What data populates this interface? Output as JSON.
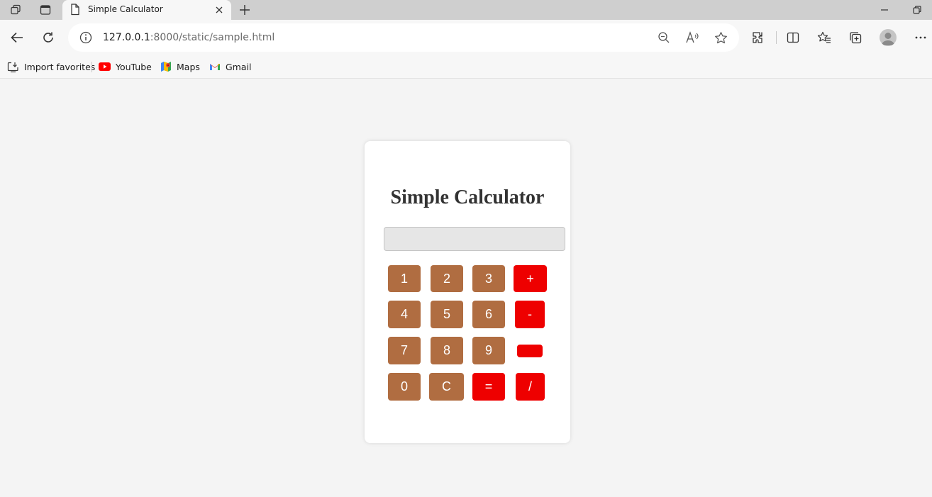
{
  "browser": {
    "tab_title": "Simple Calculator",
    "url_host": "127.0.0.1",
    "url_path": ":8000/static/sample.html",
    "bookmarks": [
      {
        "label": "Import favorites",
        "icon": "import-icon"
      },
      {
        "label": "YouTube",
        "icon": "youtube-icon"
      },
      {
        "label": "Maps",
        "icon": "maps-icon"
      },
      {
        "label": "Gmail",
        "icon": "gmail-icon"
      }
    ]
  },
  "calculator": {
    "title": "Simple Calculator",
    "display_value": "",
    "keys": {
      "k1": "1",
      "k2": "2",
      "k3": "3",
      "plus": "+",
      "k4": "4",
      "k5": "5",
      "k6": "6",
      "minus": "-",
      "k7": "7",
      "k8": "8",
      "k9": "9",
      "multiply": "",
      "k0": "0",
      "clear": "C",
      "equals": "=",
      "divide": "/"
    }
  },
  "colors": {
    "page_background": "#f4f4f4",
    "number_key": "#b06d41",
    "operator_key": "#ee0000",
    "display_background": "#e6e6e6"
  }
}
